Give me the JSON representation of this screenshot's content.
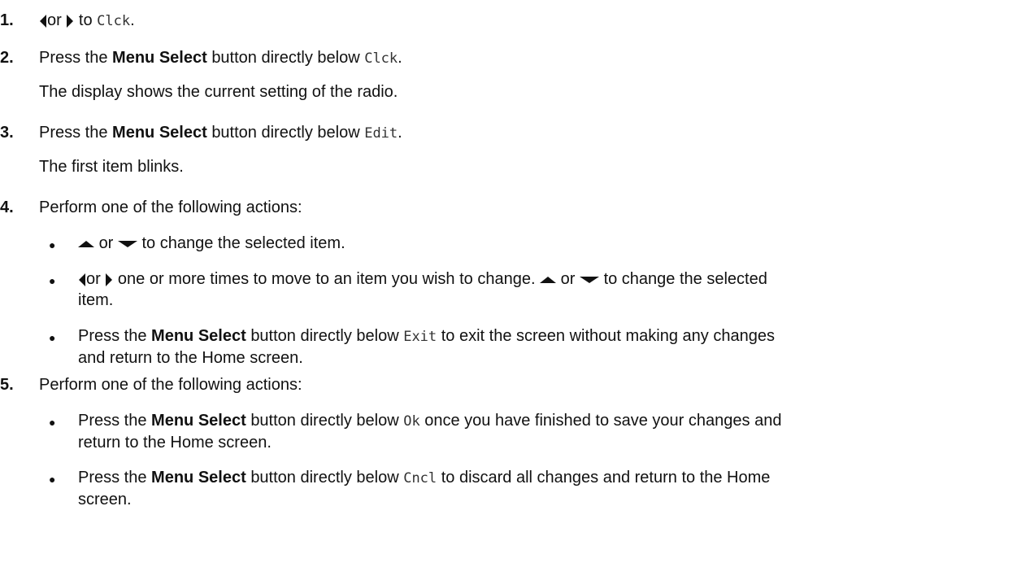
{
  "steps": [
    {
      "num": "1."
    },
    {
      "num": "2."
    },
    {
      "num": "3."
    },
    {
      "num": "4."
    },
    {
      "num": "5."
    }
  ],
  "text": {
    "or": "or",
    "s1_to": "to",
    "clck": "Clck",
    "dot": ".",
    "press_the": "Press the",
    "menu_select": "Menu Select",
    "button_below": "button directly below",
    "s2_note": "The display shows the current setting of the radio.",
    "edit": "Edit",
    "s3_note": "The first item blinks.",
    "perform": "Perform one of the following actions:",
    "b1_text": "to change the selected item.",
    "b2_text_a": "one or more times to move to an item you wish to change.",
    "b2_text_b": "to change the selected",
    "b2_text_c": "item.",
    "exit": "Exit",
    "b3_text_a": "to exit the screen without making any changes",
    "b3_text_b": "and return to the Home screen.",
    "ok": "Ok",
    "b4_text_a": "once you have finished to save your changes and",
    "b4_text_b": "return to the Home screen.",
    "cncl": "Cncl",
    "b5_text_a": "to discard all changes and return to the Home",
    "b5_text_b": "screen."
  },
  "icons": {
    "left": "left-arrow-icon",
    "right": "right-arrow-icon",
    "up": "up-arrow-icon",
    "down": "down-arrow-icon",
    "bullet": "bullet-icon"
  }
}
